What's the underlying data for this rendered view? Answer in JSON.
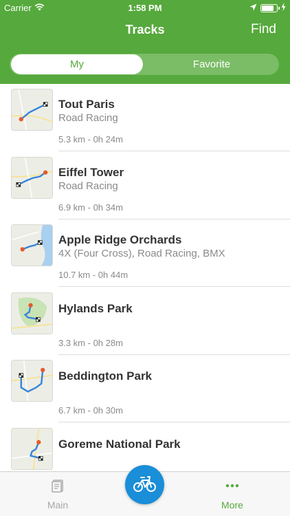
{
  "status": {
    "carrier": "Carrier",
    "time": "1:58 PM",
    "battery_level": 0.85
  },
  "nav": {
    "title": "Tracks",
    "find_label": "Find"
  },
  "segments": {
    "my": "My",
    "favorite": "Favorite",
    "selected": "My"
  },
  "tracks": [
    {
      "title": "Tout Paris",
      "subtitle": "Road Racing",
      "meta": "5.3 km - 0h 24m"
    },
    {
      "title": "Eiffel Tower",
      "subtitle": "Road Racing",
      "meta": "6.9 km - 0h 34m"
    },
    {
      "title": "Apple Ridge Orchards",
      "subtitle": "4X (Four Cross), Road Racing, BMX",
      "meta": "10.7 km - 0h 44m"
    },
    {
      "title": "Hylands Park",
      "subtitle": "",
      "meta": "3.3 km - 0h 28m"
    },
    {
      "title": "Beddington Park",
      "subtitle": "",
      "meta": "6.7 km - 0h 30m"
    },
    {
      "title": "Goreme National Park",
      "subtitle": "",
      "meta": ""
    }
  ],
  "tabbar": {
    "main_label": "Main",
    "more_label": "More",
    "active_color": "#56a93c",
    "inactive_color": "#a8a8a8"
  },
  "colors": {
    "brand": "#56a93c",
    "fab": "#1a8ed8",
    "route": "#3a86d9",
    "start_marker": "#e65a2e"
  }
}
